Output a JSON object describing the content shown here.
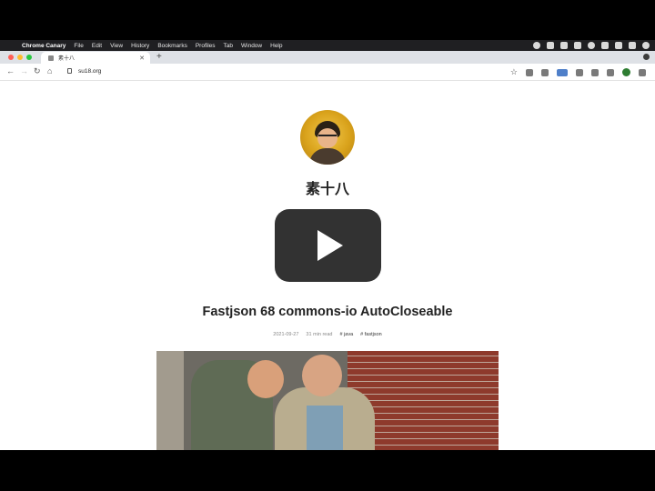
{
  "menubar": {
    "app_name": "Chrome Canary",
    "items": [
      "File",
      "Edit",
      "View",
      "History",
      "Bookmarks",
      "Profiles",
      "Tab",
      "Window",
      "Help"
    ]
  },
  "browser": {
    "tab_title": "素十八",
    "url": "su18.org",
    "colors": {
      "close": "#ff5f57",
      "minimize": "#febc2e",
      "zoom": "#28c840"
    }
  },
  "page": {
    "site_title": "素十八",
    "post_title": "Fastjson 68 commons-io AutoCloseable",
    "meta": {
      "date": "2021-09-27",
      "read": "31 min read",
      "tags": [
        "# java",
        "# fastjson"
      ]
    }
  }
}
